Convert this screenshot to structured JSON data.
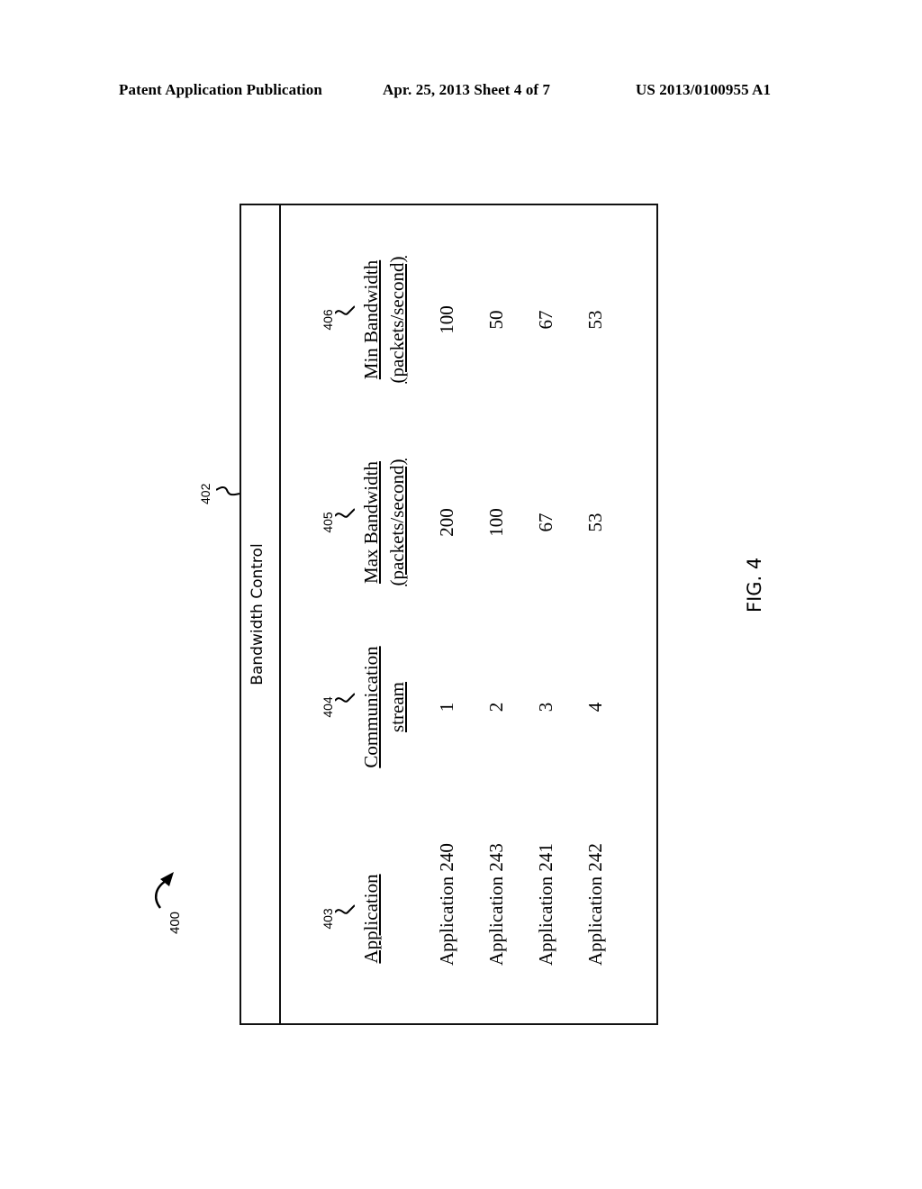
{
  "header": {
    "publication_type": "Patent Application Publication",
    "date_sheet": "Apr. 25, 2013  Sheet 4 of 7",
    "publication_number": "US 2013/0100955 A1"
  },
  "figure": {
    "reference_number": "400",
    "label": "FIG. 4",
    "table_reference": "402",
    "table_title": "Bandwidth Control",
    "columns": [
      {
        "ref": "403",
        "line1": "Application",
        "line2": ""
      },
      {
        "ref": "404",
        "line1": "Communication",
        "line2": "stream"
      },
      {
        "ref": "405",
        "line1": "Max Bandwidth",
        "line2": "(packets/second)"
      },
      {
        "ref": "406",
        "line1": "Min Bandwidth",
        "line2": "(packets/second)"
      }
    ],
    "rows": [
      [
        "Application 240",
        "1",
        "200",
        "100"
      ],
      [
        "Application 243",
        "2",
        "100",
        "50"
      ],
      [
        "Application 241",
        "3",
        "67",
        "67"
      ],
      [
        "Application 242",
        "4",
        "53",
        "53"
      ]
    ]
  }
}
